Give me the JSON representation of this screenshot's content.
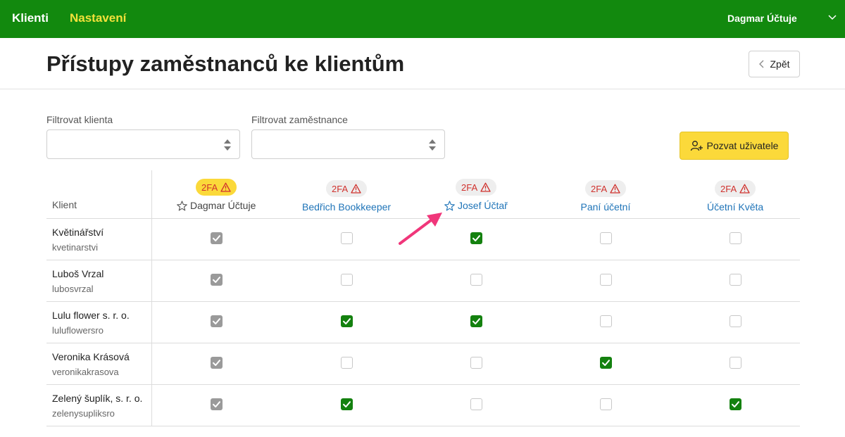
{
  "nav": {
    "klienti": "Klienti",
    "nastaveni": "Nastavení",
    "user": "Dagmar Účtuje"
  },
  "page": {
    "title": "Přístupy zaměstnanců ke klientům",
    "back_label": "Zpět"
  },
  "filters": {
    "client_label": "Filtrovat klienta",
    "employee_label": "Filtrovat zaměstnance"
  },
  "invite_label": "Pozvat uživatele",
  "table": {
    "client_header": "Klient",
    "badge_label": "2FA",
    "employees": [
      {
        "name": "Dagmar Účtuje",
        "starred": true
      },
      {
        "name": "Bedřich Bookkeeper",
        "starred": false
      },
      {
        "name": "Josef Účtař",
        "starred": true
      },
      {
        "name": "Paní účetní",
        "starred": false
      },
      {
        "name": "Účetní Květa",
        "starred": false
      }
    ],
    "rows": [
      {
        "name": "Květinářství",
        "slug": "kvetinarstvi",
        "access": [
          true,
          false,
          true,
          false,
          false
        ]
      },
      {
        "name": "Luboš Vrzal",
        "slug": "lubosvrzal",
        "access": [
          true,
          false,
          false,
          false,
          false
        ]
      },
      {
        "name": "Lulu flower s. r. o.",
        "slug": "luluflowersro",
        "access": [
          true,
          true,
          true,
          false,
          false
        ]
      },
      {
        "name": "Veronika Krásová",
        "slug": "veronikakrasova",
        "access": [
          true,
          false,
          false,
          true,
          false
        ]
      },
      {
        "name": "Zelený šuplík, s. r. o.",
        "slug": "zelenysupliksro",
        "access": [
          true,
          true,
          false,
          false,
          true
        ]
      }
    ]
  },
  "colors": {
    "header_green": "#12890e",
    "nav_yellow": "#f2e13a",
    "check_green": "#14810f",
    "link_blue": "#1f74b8",
    "warning_red": "#d0312d",
    "button_yellow": "#fbd93a"
  }
}
